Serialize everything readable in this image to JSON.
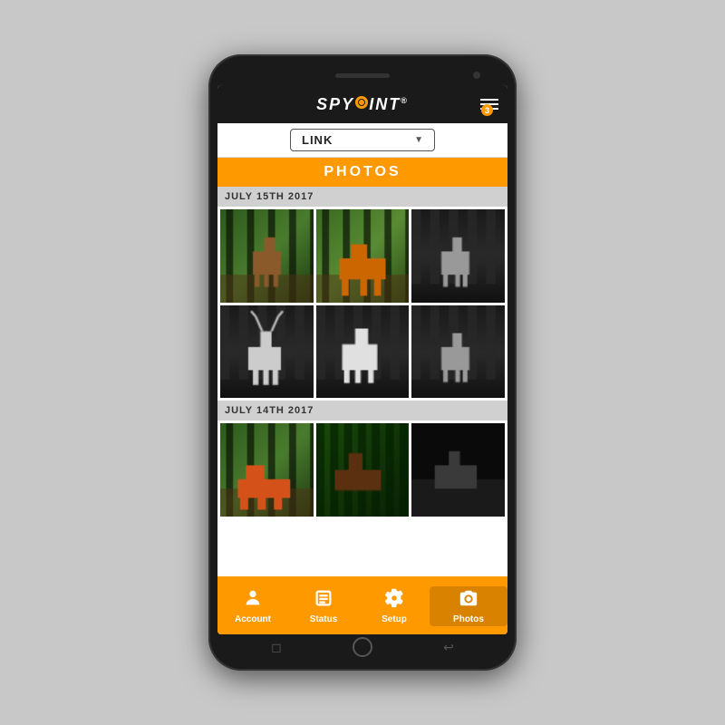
{
  "phone": {
    "speaker_label": "speaker",
    "camera_label": "front-camera"
  },
  "app": {
    "logo": {
      "spy": "SPY",
      "point": "INT",
      "dot_label": "target-dot",
      "tm": "®"
    },
    "menu_badge": "3",
    "camera_selector": {
      "current_value": "LINK",
      "placeholder": "LINK",
      "dropdown_arrow": "▼"
    },
    "photos_title": "PHOTOS",
    "date_groups": [
      {
        "date": "JULY 15TH 2017",
        "photos": [
          {
            "id": "p1",
            "type": "color_forest",
            "animal": "deer"
          },
          {
            "id": "p2",
            "type": "color_forest",
            "animal": "fox"
          },
          {
            "id": "p3",
            "type": "night",
            "animal": "deer"
          },
          {
            "id": "p4",
            "type": "night",
            "animal": "buck"
          },
          {
            "id": "p5",
            "type": "night",
            "animal": "deer_white"
          },
          {
            "id": "p6",
            "type": "night",
            "animal": "forest"
          }
        ]
      },
      {
        "date": "JULY 14TH 2017",
        "photos": [
          {
            "id": "p7",
            "type": "color_forest",
            "animal": "fox_orange"
          },
          {
            "id": "p8",
            "type": "color_dark",
            "animal": "deer"
          },
          {
            "id": "p9",
            "type": "night_dark",
            "animal": "deer"
          }
        ]
      }
    ],
    "nav": {
      "items": [
        {
          "id": "account",
          "label": "Account",
          "icon": "person",
          "active": false
        },
        {
          "id": "status",
          "label": "Status",
          "icon": "list",
          "active": false
        },
        {
          "id": "setup",
          "label": "Setup",
          "icon": "gear",
          "active": false
        },
        {
          "id": "photos",
          "label": "Photos",
          "icon": "camera",
          "active": true
        }
      ]
    }
  }
}
